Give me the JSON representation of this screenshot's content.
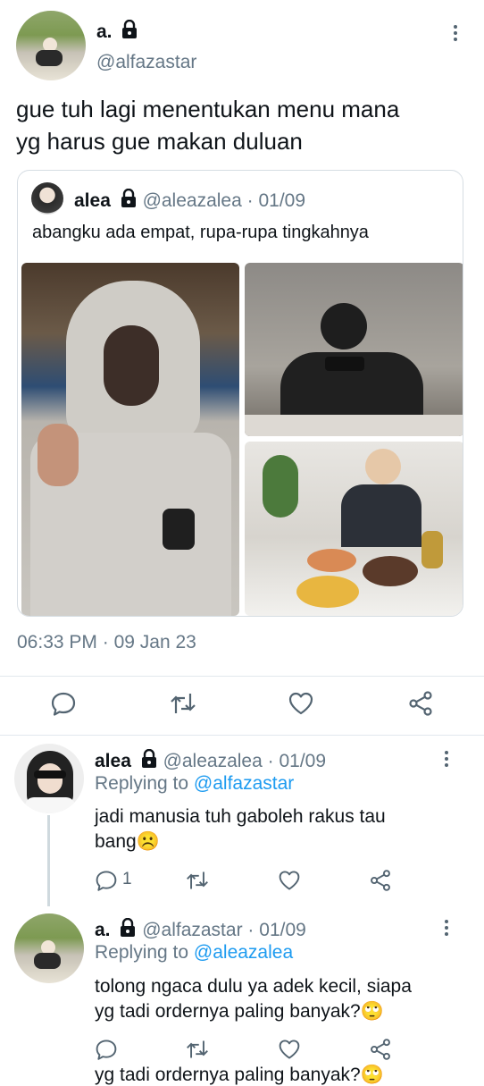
{
  "main_tweet": {
    "name": "a.",
    "handle": "@alfazastar",
    "text_line1": "gue tuh lagi menentukan menu mana",
    "text_line2": "yg harus gue makan duluan",
    "timestamp": "06:33 PM",
    "date": "09 Jan 23",
    "separator": "·"
  },
  "quoted_tweet": {
    "name": "alea",
    "handle": "@aleazalea",
    "date": "01/09",
    "separator": "·",
    "text": "abangku ada empat, rupa-rupa tingkahnya"
  },
  "reply1": {
    "name": "alea",
    "handle": "@aleazalea",
    "separator": "·",
    "date": "01/09",
    "replying_label": "Replying to",
    "replying_to": "@alfazastar",
    "text_line1": "jadi manusia tuh gaboleh rakus tau",
    "text_line2": "bang☹️",
    "reply_count": "1"
  },
  "reply2": {
    "name": "a.",
    "handle": "@alfazastar",
    "separator": "·",
    "date": "01/09",
    "replying_label": "Replying to",
    "replying_to": "@aleazalea",
    "text_line1": "tolong ngaca dulu ya adek kecil, siapa",
    "text_line2": "yg tadi ordernya paling banyak?🙄",
    "cut_off_text": "yg tadi ordernya paling banyak?🙄"
  },
  "icons": [
    "lock-icon",
    "more-icon",
    "reply-icon",
    "retweet-icon",
    "like-icon",
    "share-icon"
  ],
  "colors": {
    "link": "#1d9bf0",
    "secondary": "#657786",
    "text": "#0f1419",
    "divider": "#e1e8ed"
  }
}
